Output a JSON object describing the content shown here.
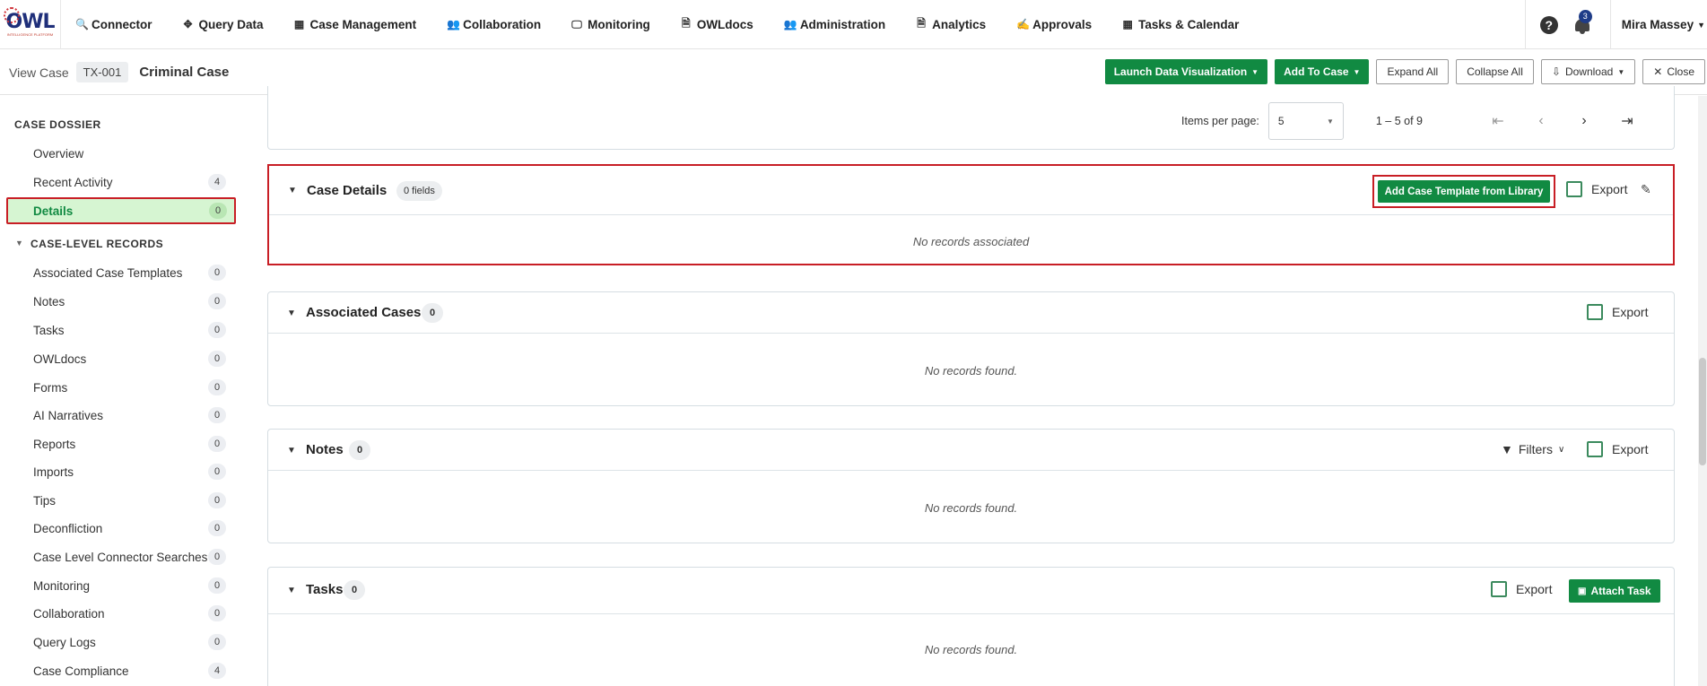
{
  "nav": {
    "logo_text": "OWL",
    "logo_sub": "INTELLIGENCE PLATFORM",
    "items": [
      {
        "label": "Connector",
        "icon": "🔍"
      },
      {
        "label": "Query Data",
        "icon": "✥"
      },
      {
        "label": "Case Management",
        "icon": "▦"
      },
      {
        "label": "Collaboration",
        "icon": "👥"
      },
      {
        "label": "Monitoring",
        "icon": "🖵"
      },
      {
        "label": "OWLdocs",
        "icon": "🗎"
      },
      {
        "label": "Administration",
        "icon": "👥"
      },
      {
        "label": "Analytics",
        "icon": "🗎"
      },
      {
        "label": "Approvals",
        "icon": "✍"
      },
      {
        "label": "Tasks & Calendar",
        "icon": "▦"
      }
    ],
    "help_glyph": "?",
    "notification_count": "3",
    "user_name": "Mira Massey"
  },
  "header": {
    "view_label": "View Case",
    "case_id": "TX-001",
    "case_title": "Criminal Case",
    "launch_viz": "Launch Data Visualization",
    "add_to_case": "Add To Case",
    "expand_all": "Expand All",
    "collapse_all": "Collapse All",
    "download": "Download",
    "close": "Close"
  },
  "sidebar": {
    "dossier_title": "CASE DOSSIER",
    "overview": "Overview",
    "recent_activity": {
      "label": "Recent Activity",
      "count": "4"
    },
    "details": {
      "label": "Details",
      "count": "0"
    },
    "records_title": "CASE-LEVEL RECORDS",
    "records": [
      {
        "label": "Associated Case Templates",
        "count": "0"
      },
      {
        "label": "Notes",
        "count": "0"
      },
      {
        "label": "Tasks",
        "count": "0"
      },
      {
        "label": "OWLdocs",
        "count": "0"
      },
      {
        "label": "Forms",
        "count": "0"
      },
      {
        "label": "AI Narratives",
        "count": "0"
      },
      {
        "label": "Reports",
        "count": "0"
      },
      {
        "label": "Imports",
        "count": "0"
      },
      {
        "label": "Tips",
        "count": "0"
      },
      {
        "label": "Deconfliction",
        "count": "0"
      },
      {
        "label": "Case Level Connector Searches",
        "count": "0"
      },
      {
        "label": "Monitoring",
        "count": "0"
      },
      {
        "label": "Collaboration",
        "count": "0"
      },
      {
        "label": "Query Logs",
        "count": "0"
      },
      {
        "label": "Case Compliance",
        "count": "4"
      }
    ]
  },
  "pager": {
    "items_per_page_label": "Items per page:",
    "items_per_page": "5",
    "range": "1 – 5 of 9"
  },
  "case_details": {
    "title": "Case Details",
    "fields_badge": "0 fields",
    "add_template_button": "Add Case Template from Library",
    "export_label": "Export",
    "empty": "No records associated"
  },
  "associated_cases": {
    "title": "Associated Cases",
    "count": "0",
    "export_label": "Export",
    "empty": "No records found."
  },
  "notes": {
    "title": "Notes",
    "count": "0",
    "filters_label": "Filters",
    "export_label": "Export",
    "empty": "No records found."
  },
  "tasks": {
    "title": "Tasks",
    "count": "0",
    "export_label": "Export",
    "attach_button": "Attach Task",
    "empty": "No records found."
  },
  "colors": {
    "brand_green": "#118a42",
    "highlight_red": "#c81e25",
    "active_bg": "#d6f5d2"
  }
}
